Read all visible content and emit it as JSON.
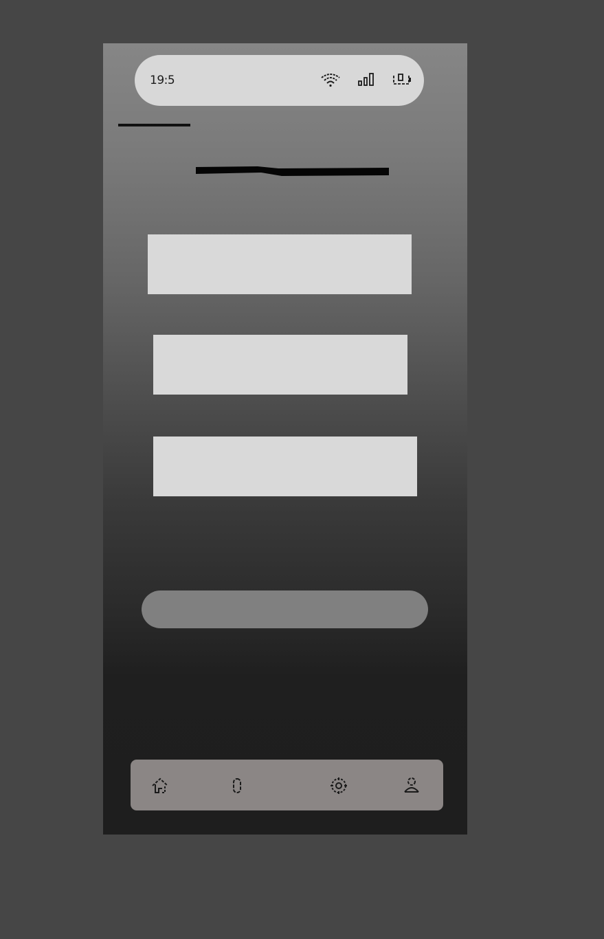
{
  "status_bar": {
    "time": "19:5",
    "icons": [
      "wifi-icon",
      "signal-icon",
      "battery-icon"
    ]
  },
  "colors": {
    "page_background": "#464646",
    "status_bar": "#d8d8d8",
    "card": "#d9d9d9",
    "pill_button": "#808080",
    "bottom_nav": "#8b8685",
    "accent": "#111111"
  },
  "bottom_nav": {
    "items": [
      {
        "id": "home",
        "icon": "home-icon"
      },
      {
        "id": "search",
        "icon": "search-icon"
      },
      {
        "id": "settings",
        "icon": "gear-icon"
      },
      {
        "id": "profile",
        "icon": "profile-icon"
      }
    ]
  }
}
